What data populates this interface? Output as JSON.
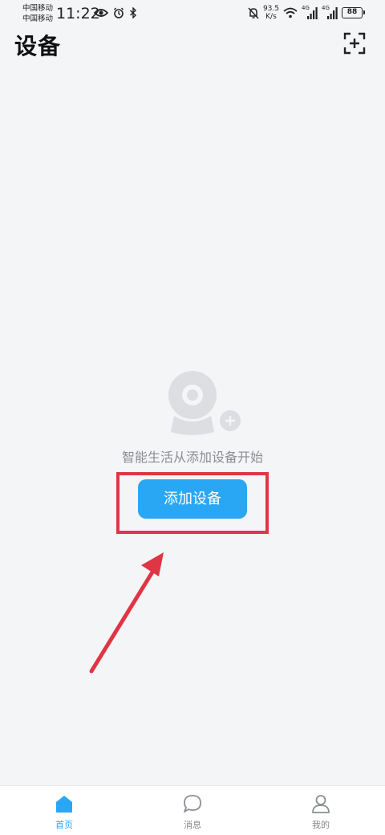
{
  "status_bar": {
    "carrier_1": "中国移动",
    "carrier_2": "中国移动",
    "time": "11:22",
    "net_speed_value": "93.5",
    "net_speed_unit": "K/s",
    "sim1_label": "4G",
    "sim2_label": "4G",
    "battery": "88"
  },
  "header": {
    "title": "设备"
  },
  "empty_state": {
    "message": "智能生活从添加设备开始",
    "add_button_label": "添加设备"
  },
  "tab_bar": {
    "tabs": [
      {
        "label": "首页",
        "icon": "home-icon",
        "active": true
      },
      {
        "label": "消息",
        "icon": "chat-bubble-icon",
        "active": false
      },
      {
        "label": "我的",
        "icon": "person-icon",
        "active": false
      }
    ]
  },
  "colors": {
    "accent": "#2aa7f4",
    "annotation_red": "#e03545",
    "background": "#f4f5f7"
  }
}
